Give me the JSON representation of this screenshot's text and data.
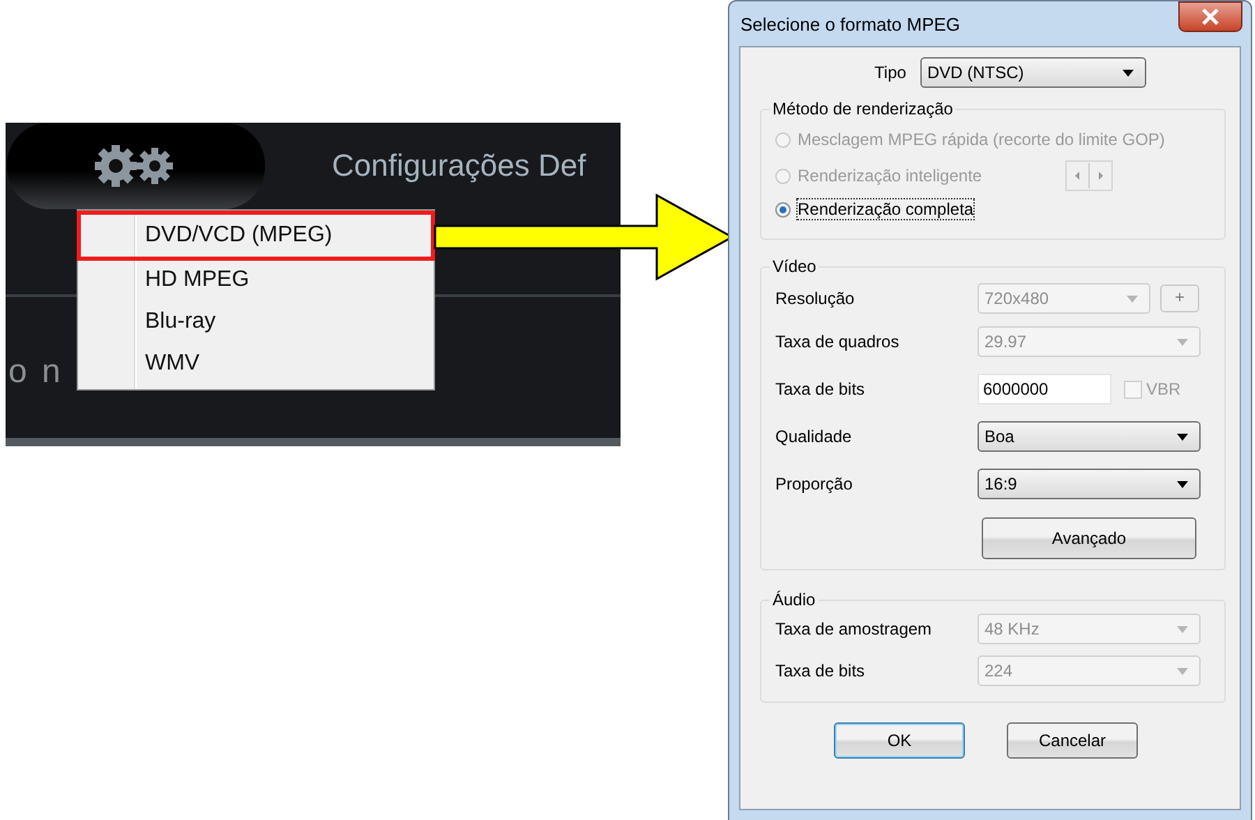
{
  "background_app": {
    "tab_label": "Configurações Def",
    "partial_text": "o n",
    "menu": {
      "items": [
        {
          "label": "DVD/VCD (MPEG)",
          "selected": true
        },
        {
          "label": "HD MPEG",
          "selected": false
        },
        {
          "label": "Blu-ray",
          "selected": false
        },
        {
          "label": "WMV",
          "selected": false
        }
      ]
    }
  },
  "dialog": {
    "title": "Selecione o formato MPEG",
    "type": {
      "label": "Tipo",
      "value": "DVD (NTSC)"
    },
    "render_method": {
      "title": "Método de renderização",
      "options": [
        {
          "label": "Mesclagem MPEG rápida (recorte do limite GOP)",
          "selected": false,
          "disabled": true
        },
        {
          "label": "Renderização inteligente",
          "selected": false,
          "disabled": true,
          "stepper": true
        },
        {
          "label": "Renderização completa",
          "selected": true,
          "disabled": false
        }
      ]
    },
    "video": {
      "title": "Vídeo",
      "rows": [
        {
          "kind": "dropdown",
          "label": "Resolução",
          "value": "720x480",
          "disabled": true,
          "add_button": "+"
        },
        {
          "kind": "dropdown",
          "label": "Taxa de quadros",
          "value": "29.97",
          "disabled": true
        },
        {
          "kind": "text",
          "label": "Taxa de bits",
          "value": "6000000",
          "checkbox": {
            "label": "VBR",
            "checked": false,
            "disabled": true
          }
        },
        {
          "kind": "dropdown",
          "label": "Qualidade",
          "value": "Boa",
          "disabled": false
        },
        {
          "kind": "dropdown",
          "label": "Proporção",
          "value": "16:9",
          "disabled": false
        }
      ],
      "advanced_button": "Avançado"
    },
    "audio": {
      "title": "Áudio",
      "rows": [
        {
          "kind": "dropdown",
          "label": "Taxa de amostragem",
          "value": "48 KHz",
          "disabled": true
        },
        {
          "kind": "dropdown",
          "label": "Taxa de bits",
          "value": "224",
          "disabled": true
        }
      ]
    },
    "buttons": [
      {
        "label": "OK",
        "default": true
      },
      {
        "label": "Cancelar",
        "default": false
      }
    ]
  }
}
